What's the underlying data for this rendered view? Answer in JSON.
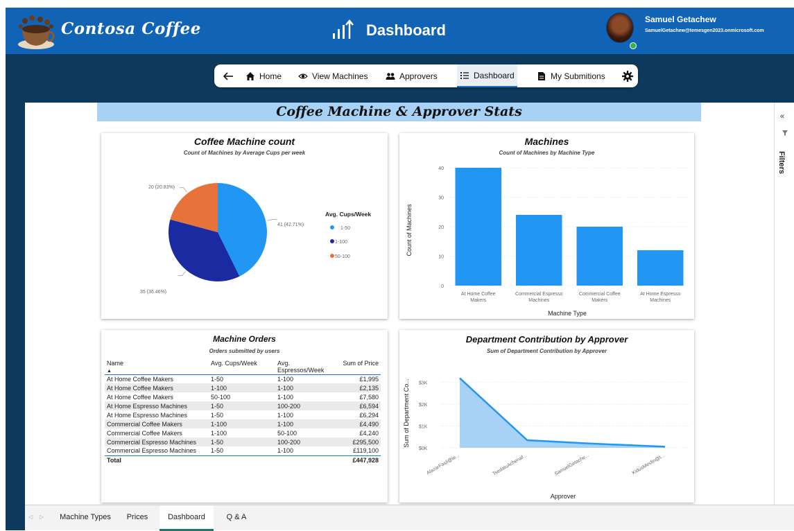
{
  "header": {
    "brand": "Contosa Coffee",
    "title": "Dashboard",
    "user_name": "Samuel Getachew",
    "user_email": "SamuelGetachew@temesgen2023.onmicrosoft.com"
  },
  "nav": {
    "items": [
      {
        "label": "Home",
        "icon": "home-icon"
      },
      {
        "label": "View Machines",
        "icon": "eye-icon"
      },
      {
        "label": "Approvers",
        "icon": "users-icon"
      },
      {
        "label": "Dashboard",
        "icon": "list-icon"
      },
      {
        "label": "My Submitions",
        "icon": "document-icon"
      }
    ],
    "active": "Dashboard"
  },
  "report": {
    "banner": "Coffee Machine & Approver Stats"
  },
  "pie_card": {
    "title": "Coffee Machine count",
    "subtitle": "Count of Machines by Average Cups per week",
    "slice_labels": [
      "41 (42.71%)",
      "35 (36.46%)",
      "20 (20.83%)"
    ],
    "legend_title": "Avg. Cups/Week",
    "legend": [
      "1-50",
      "1-100",
      "50-100"
    ]
  },
  "bar_card": {
    "title": "Machines",
    "subtitle": "Count of Machines by Machine Type",
    "ylabel": "Count of Machines",
    "xlabel": "Machine Type"
  },
  "table_card": {
    "title": "Machine Orders",
    "subtitle": "Orders submitted by users",
    "columns": [
      "Name",
      "Avg. Cups/Week",
      "Avg. Espressos/Week",
      "Sum of Price"
    ],
    "rows": [
      [
        "At Home Coffee Makers",
        "1-50",
        "1-100",
        "£1,995"
      ],
      [
        "At Home Coffee Makers",
        "1-100",
        "1-100",
        "£2,135"
      ],
      [
        "At Home Coffee Makers",
        "50-100",
        "1-100",
        "£7,580"
      ],
      [
        "At Home Espresso Machines",
        "1-50",
        "100-200",
        "£6,594"
      ],
      [
        "At Home Espresso Machines",
        "1-50",
        "1-100",
        "£6,294"
      ],
      [
        "Commercial Coffee Makers",
        "1-100",
        "1-100",
        "£4,490"
      ],
      [
        "Commercial Coffee Makers",
        "1-100",
        "50-100",
        "£4,240"
      ],
      [
        "Commercial Espresso Machines",
        "1-50",
        "100-200",
        "£295,500"
      ],
      [
        "Commercial Espresso Machines",
        "1-50",
        "1-100",
        "£119,100"
      ]
    ],
    "total_label": "Total",
    "total_value": "£447,928"
  },
  "area_card": {
    "title": "Department Contribution by Approver",
    "subtitle": "Sum of Department Contribution by Approver",
    "ylabel": "Sum of Department Co...",
    "xlabel": "Approver"
  },
  "filters": {
    "label": "Filters"
  },
  "tabs": {
    "items": [
      "Machine Types",
      "Prices",
      "Dashboard",
      "Q & A"
    ],
    "active": "Dashboard"
  },
  "colors": {
    "header_blue": "#1163b5",
    "background_navy": "#0d3a5c",
    "banner_blue": "#a8d2f5",
    "bar_blue": "#2196f3",
    "pie_light_blue": "#2196f3",
    "pie_navy": "#1a2aa0",
    "pie_orange": "#e8733a"
  },
  "chart_data": [
    {
      "type": "pie",
      "title": "Coffee Machine count",
      "subtitle": "Count of Machines by Average Cups per week",
      "legend_title": "Avg. Cups/Week",
      "legend_position": "right",
      "slices": [
        {
          "name": "1-50",
          "value": 41,
          "percent": 42.71,
          "color": "#2196f3",
          "label": "41 (42.71%)"
        },
        {
          "name": "1-100",
          "value": 35,
          "percent": 36.46,
          "color": "#1a2aa0",
          "label": "35 (36.46%)"
        },
        {
          "name": "50-100",
          "value": 20,
          "percent": 20.83,
          "color": "#e8733a",
          "label": "20 (20.83%)"
        }
      ]
    },
    {
      "type": "bar",
      "title": "Machines",
      "subtitle": "Count of Machines by Machine Type",
      "categories": [
        "At Home Coffee Makers",
        "Commercial Espresso Machines",
        "Commercial Coffee Makers",
        "At Home Espresso Machines"
      ],
      "values": [
        40,
        24,
        20,
        12
      ],
      "xlabel": "Machine Type",
      "ylabel": "Count of Machines",
      "ylim": [
        0,
        40
      ],
      "yticks": [
        0,
        10,
        20,
        30,
        40
      ],
      "grid": true,
      "color": "#2196f3"
    },
    {
      "type": "area",
      "title": "Department Contribution by Approver",
      "subtitle": "Sum of Department Contribution by Approver",
      "categories": [
        "AlazarFasil@te...",
        "TsedaluAchenaf...",
        "SamuelGetache...",
        "KidusMesfin@t..."
      ],
      "values": [
        3200,
        350,
        200,
        50
      ],
      "xlabel": "Approver",
      "ylabel": "Sum of Department Co...",
      "ylim": [
        0,
        3500
      ],
      "yticks": [
        0,
        1000,
        2000,
        3000
      ],
      "ytick_labels": [
        "$0K",
        "$1K",
        "$2K",
        "$3K"
      ],
      "grid": true,
      "color": "#2196f3"
    }
  ]
}
